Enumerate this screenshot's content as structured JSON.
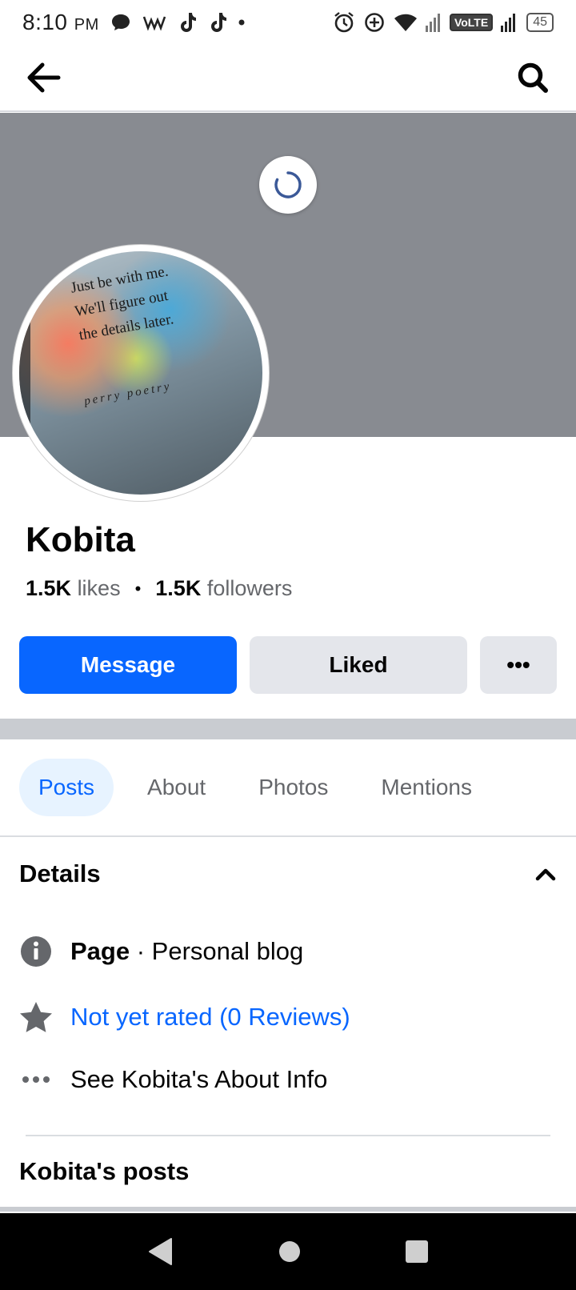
{
  "status_bar": {
    "time": "8:10",
    "ampm": "PM",
    "network_label": "VoLTE",
    "battery": "45"
  },
  "app_bar": {
    "back_icon": "arrow-left-icon",
    "search_icon": "search-icon"
  },
  "avatar": {
    "quote_lines": [
      "Just be with me.",
      "We'll figure out",
      "the details later."
    ],
    "signature": "perry poetry"
  },
  "profile": {
    "name": "Kobita",
    "likes_count": "1.5K",
    "likes_label": "likes",
    "followers_count": "1.5K",
    "followers_label": "followers"
  },
  "actions": {
    "message_label": "Message",
    "liked_label": "Liked",
    "more_label": "•••"
  },
  "tabs": [
    {
      "label": "Posts",
      "active": true
    },
    {
      "label": "About",
      "active": false
    },
    {
      "label": "Photos",
      "active": false
    },
    {
      "label": "Mentions",
      "active": false
    }
  ],
  "details": {
    "title": "Details",
    "page_label": "Page",
    "page_category": "· Personal blog",
    "rating_text": "Not yet rated (0 Reviews)",
    "about_info_text": "See Kobita's About Info"
  },
  "posts_section": {
    "title": "Kobita's posts"
  },
  "colors": {
    "accent": "#0866ff",
    "button_gray": "#e4e6eb",
    "cover_gray": "#888b91",
    "tab_active_bg": "#e7f3ff"
  }
}
